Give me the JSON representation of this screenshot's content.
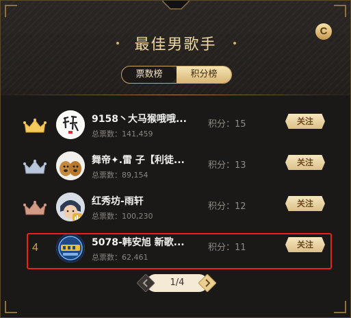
{
  "header": {
    "title": "最佳男歌手",
    "coin_icon_letter": "C"
  },
  "tabs": [
    {
      "label": "票数榜",
      "active": true
    },
    {
      "label": "积分榜",
      "active": false
    }
  ],
  "rows": [
    {
      "rank": "1",
      "rank_icon": "gold-crown-icon",
      "name": "9158丶大马猴哦哦...",
      "votes": "总票数：141,459",
      "score": "积分：15",
      "follow": "关注"
    },
    {
      "rank": "2",
      "rank_icon": "silver-crown-icon",
      "name": "舞帝✦.雷 子【利徒...",
      "votes": "总票数：89,154",
      "score": "积分：13",
      "follow": "关注"
    },
    {
      "rank": "3",
      "rank_icon": "bronze-crown-icon",
      "name": "红秀坊-雨轩",
      "votes": "总票数：100,230",
      "score": "积分：12",
      "follow": "关注"
    },
    {
      "rank": "4",
      "name": "5078-韩安旭 新歌...",
      "votes": "总票数：62,461",
      "score": "积分：11",
      "follow": "关注"
    }
  ],
  "pager": {
    "text": "1/4"
  },
  "colors": {
    "gold": "#f1d9a0",
    "crown_gold": "#f4c95d",
    "crown_silver": "#b9c6db",
    "crown_bronze": "#d39a86",
    "highlight": "#e8231b"
  }
}
